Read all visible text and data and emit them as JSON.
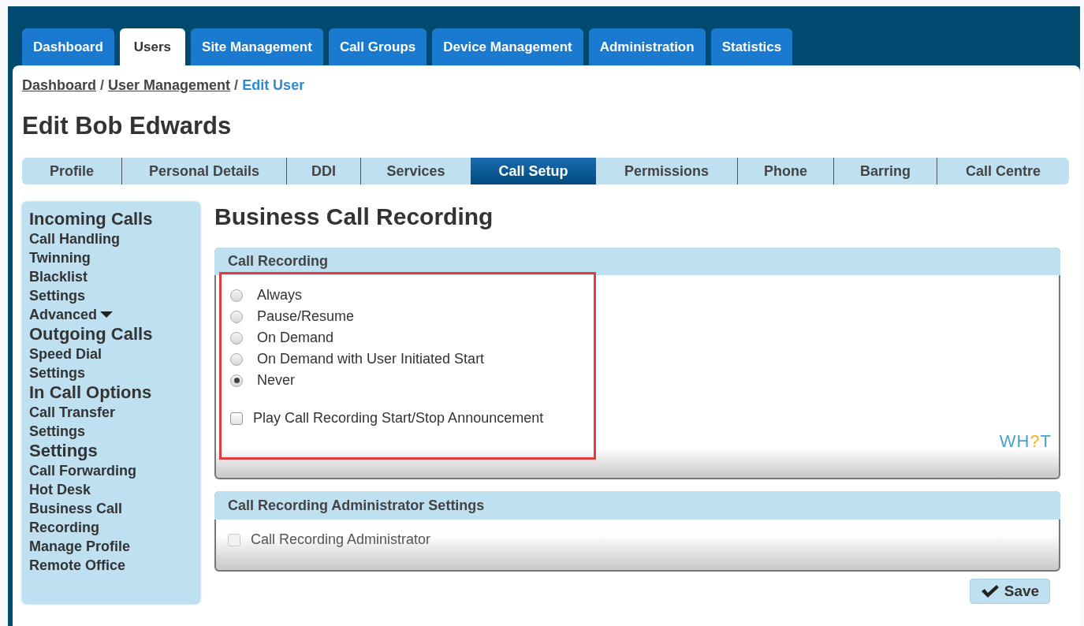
{
  "main_tabs": [
    {
      "label": "Dashboard",
      "selected": false
    },
    {
      "label": "Users",
      "selected": true
    },
    {
      "label": "Site Management",
      "selected": false
    },
    {
      "label": "Call Groups",
      "selected": false
    },
    {
      "label": "Device Management",
      "selected": false
    },
    {
      "label": "Administration",
      "selected": false
    },
    {
      "label": "Statistics",
      "selected": false
    }
  ],
  "breadcrumb": [
    {
      "label": "Dashboard",
      "kind": "link"
    },
    {
      "label": "User Management",
      "kind": "link"
    },
    {
      "label": "Edit User",
      "kind": "current"
    }
  ],
  "breadcrumb_separator": "/",
  "title": "Edit Bob Edwards",
  "sub_tabs": [
    {
      "label": "Profile",
      "selected": false
    },
    {
      "label": "Personal Details",
      "selected": false
    },
    {
      "label": "DDI",
      "selected": false
    },
    {
      "label": "Services",
      "selected": false
    },
    {
      "label": "Call Setup",
      "selected": true
    },
    {
      "label": "Permissions",
      "selected": false
    },
    {
      "label": "Phone",
      "selected": false
    },
    {
      "label": "Barring",
      "selected": false
    },
    {
      "label": "Call Centre",
      "selected": false
    }
  ],
  "sidebar": {
    "sections": [
      {
        "heading": "Incoming Calls",
        "items": [
          {
            "label": "Call Handling",
            "dropdown": false
          },
          {
            "label": "Twinning",
            "dropdown": false
          },
          {
            "label": "Blacklist",
            "dropdown": false
          },
          {
            "label": "Settings",
            "dropdown": false
          },
          {
            "label": "Advanced",
            "dropdown": true
          }
        ]
      },
      {
        "heading": "Outgoing Calls",
        "items": [
          {
            "label": "Speed Dial",
            "dropdown": false
          },
          {
            "label": "Settings",
            "dropdown": false
          }
        ]
      },
      {
        "heading": "In Call Options",
        "items": [
          {
            "label": "Call Transfer",
            "dropdown": false
          },
          {
            "label": "Settings",
            "dropdown": false
          }
        ]
      },
      {
        "heading": "Settings",
        "items": [
          {
            "label": "Call Forwarding",
            "dropdown": false
          },
          {
            "label": "Hot Desk",
            "dropdown": false
          },
          {
            "label": "Business Call Recording",
            "dropdown": false
          },
          {
            "label": "Manage Profile",
            "dropdown": false
          },
          {
            "label": "Remote Office",
            "dropdown": false
          }
        ]
      }
    ]
  },
  "page_heading": "Business Call Recording",
  "recording_panel": {
    "title": "Call Recording",
    "highlighted": true,
    "options": [
      {
        "label": "Always",
        "selected": false
      },
      {
        "label": "Pause/Resume",
        "selected": false
      },
      {
        "label": "On Demand",
        "selected": false
      },
      {
        "label": "On Demand with User Initiated Start",
        "selected": false
      },
      {
        "label": "Never",
        "selected": true
      }
    ],
    "announcement": {
      "label": "Play Call Recording Start/Stop Announcement",
      "checked": false,
      "disabled": false
    },
    "logo": [
      "WH",
      "?",
      "T"
    ]
  },
  "admin_panel": {
    "title": "Call Recording Administrator Settings",
    "checkbox": {
      "label": "Call Recording Administrator",
      "checked": false,
      "disabled": true
    }
  },
  "save_button": "Save"
}
